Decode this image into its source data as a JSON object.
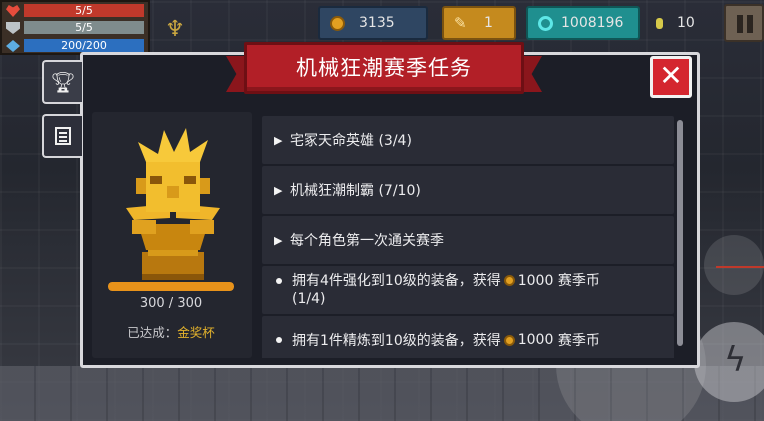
{
  "player": {
    "hp": "5/5",
    "armor": "5/5",
    "energy": "200/200"
  },
  "currencies": {
    "gold": "3135",
    "feathers": "1",
    "gems": "1008196",
    "tokens": "10"
  },
  "modal": {
    "title": "机械狂潮赛季任务",
    "close_icon": "close-icon"
  },
  "trophy": {
    "progress_text": "300 / 300",
    "progress_fraction": 1.0,
    "achieved_label": "已达成：",
    "achieved_value": "金奖杯"
  },
  "tasks": [
    {
      "text": "宅冢天命英雄 (3/4)",
      "marker": "expand"
    },
    {
      "text": "机械狂潮制霸 (7/10)",
      "marker": "expand"
    },
    {
      "text": "每个角色第一次通关赛季",
      "marker": "expand"
    },
    {
      "text_before": "拥有4件强化到10级的装备，获得",
      "amount": "1000",
      "text_after": "赛季币",
      "line2": "(1/4)",
      "marker": "dot"
    },
    {
      "text_before": "拥有1件精炼到10级的装备，获得",
      "amount": "1000",
      "text_after": "赛季币",
      "marker": "dot"
    }
  ],
  "colors": {
    "banner": "#b21f27",
    "progress": "#e8921a",
    "gold_text": "#e3b22c"
  }
}
